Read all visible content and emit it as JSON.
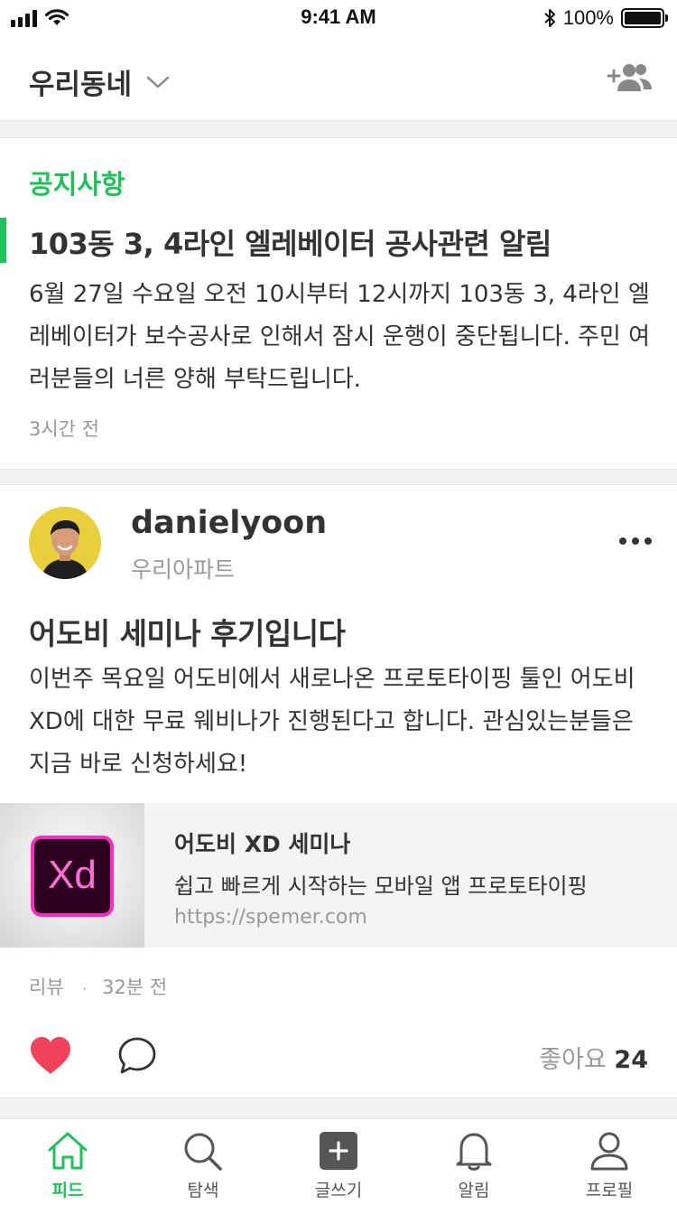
{
  "status_bar": {
    "time": "9:41 AM",
    "battery": "100%",
    "battery_level": 1.0
  },
  "header": {
    "title": "우리동네"
  },
  "notice": {
    "label": "공지사항",
    "title": "103동 3, 4라인 엘레베이터 공사관련 알림",
    "body": "6월 27일 수요일 오전 10시부터 12시까지 103동 3, 4라인 엘레베이터가 보수공사로 인해서 잠시 운행이 중단됩니다. 주민 여러분들의 너른 양해 부탁드립니다.",
    "time": "3시간 전"
  },
  "post": {
    "author": "danielyoon",
    "author_sub": "우리아파트",
    "title": "어도비 세미나 후기입니다",
    "body": "이번주 목요일 어도비에서 새로나온 프로토타이핑 툴인 어도비 XD에 대한 무료 웨비나가 진행된다고 합니다. 관심있는분들은 지금 바로 신청하세요!",
    "link": {
      "logo_text": "Xd",
      "title": "어도비 XD 세미나",
      "description": "쉽고 빠르게 시작하는 모바일 앱 프로토타이핑",
      "url": "https://spemer.com"
    },
    "category": "리뷰",
    "separator": "·",
    "time": "32분 전",
    "likes_label": "좋아요",
    "likes_count": "24"
  },
  "tabs": [
    {
      "label": "피드",
      "icon": "home-icon",
      "active": true
    },
    {
      "label": "탐색",
      "icon": "search-icon",
      "active": false
    },
    {
      "label": "글쓰기",
      "icon": "write-icon",
      "active": false
    },
    {
      "label": "알림",
      "icon": "bell-icon",
      "active": false
    },
    {
      "label": "프로필",
      "icon": "profile-icon",
      "active": false
    }
  ],
  "colors": {
    "accent": "#21c05a",
    "like": "#f0435a",
    "text": "#333333",
    "muted": "#999999"
  }
}
